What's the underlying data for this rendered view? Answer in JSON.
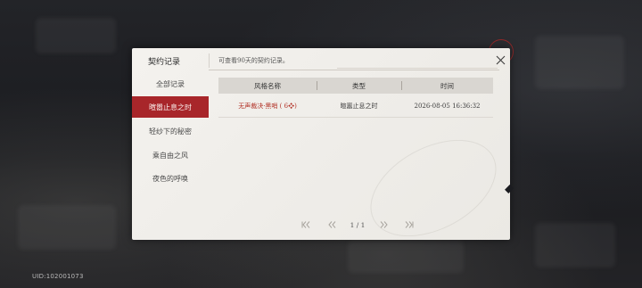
{
  "uid": "UID:102001073",
  "dialog": {
    "title": "契约记录",
    "hint": "可查看90天的契约记录。",
    "close_icon": "close-icon"
  },
  "sidebar": {
    "items": [
      {
        "label": "全部记录",
        "active": false
      },
      {
        "label": "暄嚣止息之时",
        "active": true
      },
      {
        "label": "轻纱下的秘密",
        "active": false
      },
      {
        "label": "乘自由之风",
        "active": false
      },
      {
        "label": "夜色的呼唤",
        "active": false
      }
    ]
  },
  "table": {
    "columns": [
      "风格名称",
      "类型",
      "时间"
    ],
    "rows": [
      {
        "name": "无声裁决·黑哨 ( 6❖)",
        "type": "暄嚣止息之时",
        "time": "2026-08-05 16:36:32"
      }
    ]
  },
  "pager": {
    "first_icon": "first-page-icon",
    "prev_icon": "prev-page-icon",
    "next_icon": "next-page-icon",
    "last_icon": "last-page-icon",
    "page_text": "1 / 1"
  },
  "colors": {
    "accent": "#a8262a",
    "name_red": "#b23227"
  }
}
